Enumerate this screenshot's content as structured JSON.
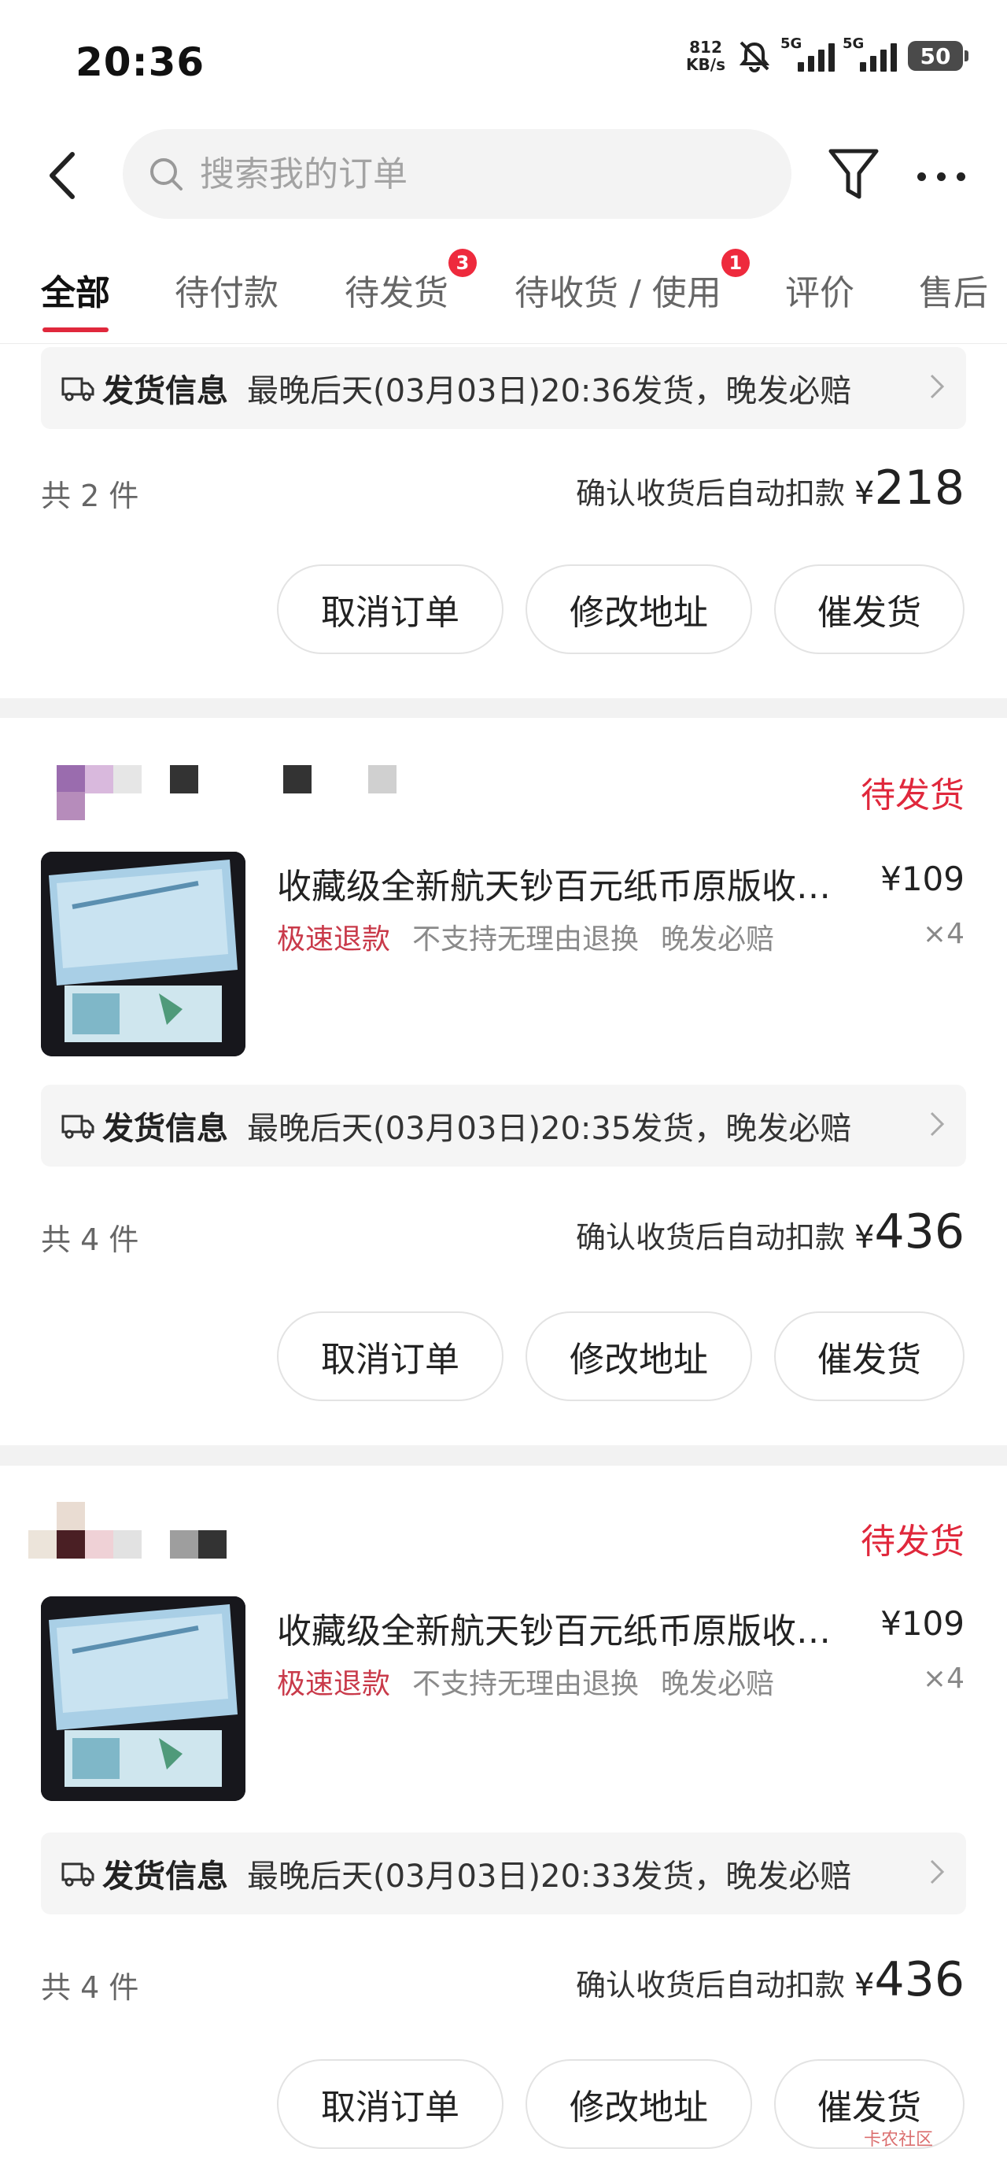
{
  "status_bar": {
    "time": "20:36",
    "net_speed_value": "812",
    "net_speed_unit": "KB/s",
    "sim1": "5G",
    "sim2": "5G",
    "battery": "50"
  },
  "header": {
    "search_placeholder": "搜索我的订单"
  },
  "tabs": [
    {
      "label": "全部",
      "active": true
    },
    {
      "label": "待付款"
    },
    {
      "label": "待发货",
      "badge": "3"
    },
    {
      "label": "待收货 / 使用",
      "badge": "1"
    },
    {
      "label": "评价"
    },
    {
      "label": "售后"
    }
  ],
  "orders": [
    {
      "ship_label": "发货信息",
      "ship_text": "最晚后天(03月03日)20:36发货，晚发必赔",
      "count": "共 2 件",
      "total_label": "确认收货后自动扣款",
      "currency": "¥",
      "total": "218",
      "buttons": [
        "取消订单",
        "修改地址",
        "催发货"
      ]
    },
    {
      "status": "待发货",
      "product_title": "收藏级全新航天钞百元纸币原版收…",
      "price": "¥109",
      "quantity": "×4",
      "tags": [
        "极速退款",
        "不支持无理由退换",
        "晚发必赔"
      ],
      "ship_label": "发货信息",
      "ship_text": "最晚后天(03月03日)20:35发货，晚发必赔",
      "count": "共 4 件",
      "total_label": "确认收货后自动扣款",
      "currency": "¥",
      "total": "436",
      "buttons": [
        "取消订单",
        "修改地址",
        "催发货"
      ]
    },
    {
      "status": "待发货",
      "product_title": "收藏级全新航天钞百元纸币原版收…",
      "price": "¥109",
      "quantity": "×4",
      "tags": [
        "极速退款",
        "不支持无理由退换",
        "晚发必赔"
      ],
      "ship_label": "发货信息",
      "ship_text": "最晚后天(03月03日)20:33发货，晚发必赔",
      "count": "共 4 件",
      "total_label": "确认收货后自动扣款",
      "currency": "¥",
      "total": "436",
      "buttons": [
        "取消订单",
        "修改地址",
        "催发货"
      ]
    }
  ],
  "watermark": "卡农社区",
  "colors": {
    "accent": "#e0283c",
    "tag_red": "#c93a4a",
    "background": "#f2f2f2"
  }
}
